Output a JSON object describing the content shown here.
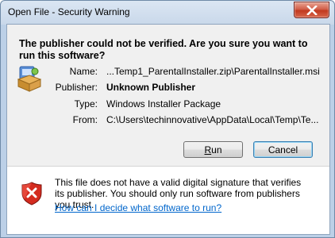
{
  "window": {
    "title": "Open File - Security Warning"
  },
  "heading": "The publisher could not be verified.  Are you sure you want to run this software?",
  "fields": {
    "name": {
      "label": "Name:",
      "value": "...Temp1_ParentalInstaller.zip\\ParentalInstaller.msi"
    },
    "publisher": {
      "label": "Publisher:",
      "value": "Unknown Publisher"
    },
    "type": {
      "label": "Type:",
      "value": "Windows Installer Package"
    },
    "from": {
      "label": "From:",
      "value": "C:\\Users\\techinnovative\\AppData\\Local\\Temp\\Te..."
    }
  },
  "buttons": {
    "run_prefix": "",
    "run_accel": "R",
    "run_suffix": "un",
    "cancel": "Cancel"
  },
  "warning": {
    "text": "This file does not have a valid digital signature that verifies its publisher.  You should only run software from publishers you trust.",
    "link": "How can I decide what software to run?"
  },
  "icons": {
    "close": "close-x-icon",
    "package": "installer-package-icon",
    "shield": "security-shield-warning-icon"
  }
}
